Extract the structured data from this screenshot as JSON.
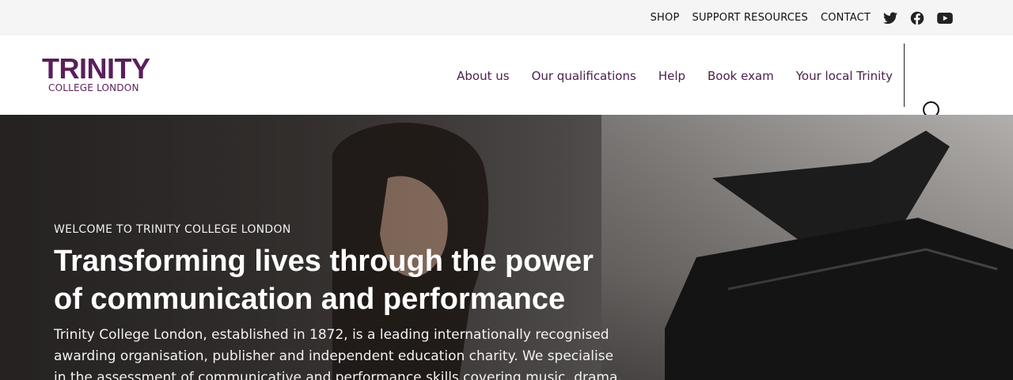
{
  "topbar": {
    "links": [
      "SHOP",
      "SUPPORT RESOURCES",
      "CONTACT"
    ],
    "social": [
      "twitter-icon",
      "facebook-icon",
      "youtube-icon"
    ]
  },
  "brand": {
    "name": "TRINITY",
    "sub": "COLLEGE LONDON",
    "color": "#5a1f5a"
  },
  "nav": [
    "About us",
    "Our qualifications",
    "Help",
    "Book exam",
    "Your local Trinity"
  ],
  "search": {
    "icon": "search-icon"
  },
  "hero": {
    "eyebrow": "WELCOME TO TRINITY COLLEGE LONDON",
    "headline": "Transforming lives through the power of communication and performance",
    "body": "Trinity College London, established in 1872, is a leading internationally recognised awarding organisation, publisher and independent education charity. We specialise in the assessment of communicative and performance skills covering music, drama,"
  }
}
